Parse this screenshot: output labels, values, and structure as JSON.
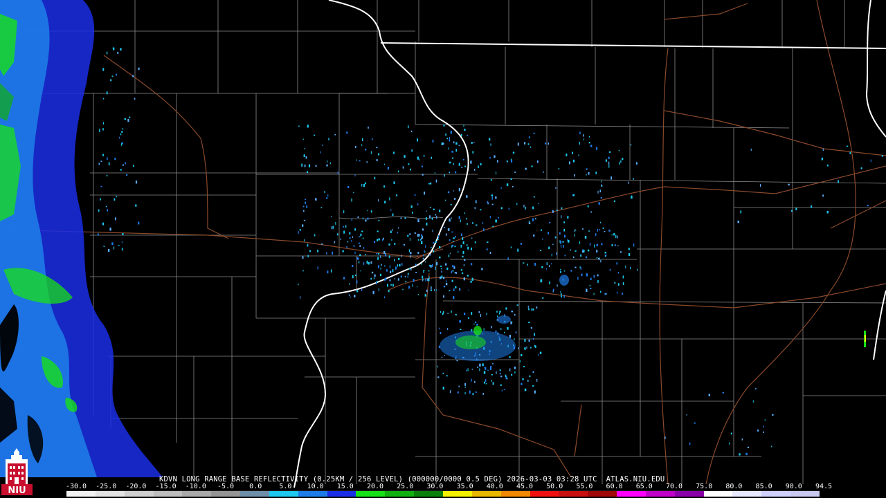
{
  "map": {
    "caption": "KDVN LONG RANGE BASE REFLECTIVITY (0.25KM / 256 LEVEL) (000000/0000 0.5 DEG) 2026-03-03 03:28 UTC  ATLAS.NIU.EDU",
    "logo_text": "NIU",
    "colors": {
      "background": "#000000",
      "state_border": "#ffffff",
      "county_border": "#8c8c8c",
      "highway": "#8b4a2b"
    }
  },
  "legend": {
    "labels": [
      "-30.0",
      "-25.0",
      "-20.0",
      "-15.0",
      "-10.0",
      "-5.0",
      "0.0",
      "5.0",
      "10.0",
      "15.0",
      "20.0",
      "25.0",
      "30.0",
      "35.0",
      "40.0",
      "45.0",
      "50.0",
      "55.0",
      "60.0",
      "65.0",
      "70.0",
      "75.0",
      "80.0",
      "85.0",
      "90.0",
      "94.5"
    ],
    "colors": [
      "#f2f2f2",
      "#e3e3e3",
      "#cfcfcf",
      "#bdbdbd",
      "#a9a9a9",
      "#959595",
      "#6f8fa8",
      "#1ec8ee",
      "#1e7ce8",
      "#1a2ee6",
      "#18e018",
      "#10b010",
      "#0a800a",
      "#f2f200",
      "#e8b800",
      "#f08800",
      "#f01010",
      "#c81010",
      "#a00808",
      "#ff00ff",
      "#c000c8",
      "#8a00a8",
      "#ffffff",
      "#e8e8ff",
      "#d0d0ff",
      "#c8c8f0"
    ]
  }
}
